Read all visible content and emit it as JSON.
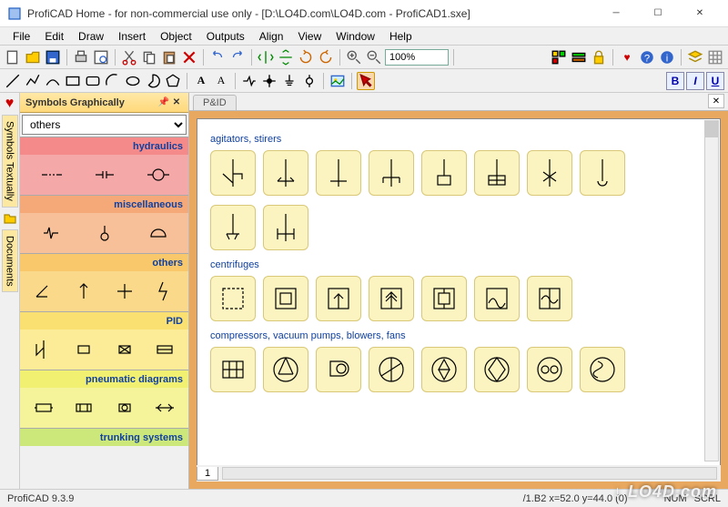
{
  "window": {
    "title": "ProfiCAD Home - for non-commercial use only - [D:\\LO4D.com\\LO4D.com - ProfiCAD1.sxe]"
  },
  "menu": {
    "items": [
      "File",
      "Edit",
      "Draw",
      "Insert",
      "Object",
      "Outputs",
      "Align",
      "View",
      "Window",
      "Help"
    ]
  },
  "toolbar": {
    "zoom": "100%"
  },
  "sidebar": {
    "panel_title": "Symbols Graphically",
    "dropdown": "others",
    "vertical_tabs": {
      "textually": "Symbols Textually",
      "documents": "Documents"
    },
    "categories": [
      {
        "name": "hydraulics"
      },
      {
        "name": "miscellaneous"
      },
      {
        "name": "others"
      },
      {
        "name": "PID"
      },
      {
        "name": "pneumatic diagrams"
      },
      {
        "name": "trunking systems"
      }
    ]
  },
  "document": {
    "tab": "P&ID",
    "sheet": "1",
    "sections": [
      {
        "title": "agitators, stirers"
      },
      {
        "title": "centrifuges"
      },
      {
        "title": "compressors, vacuum pumps, blowers, fans"
      }
    ]
  },
  "statusbar": {
    "version": "ProfiCAD 9.3.9",
    "coords": "/1.B2   x=52.0   y=44.0 (0)",
    "num": "NUM",
    "scrl": "SCRL"
  },
  "watermark": "↓ LO4D.com"
}
